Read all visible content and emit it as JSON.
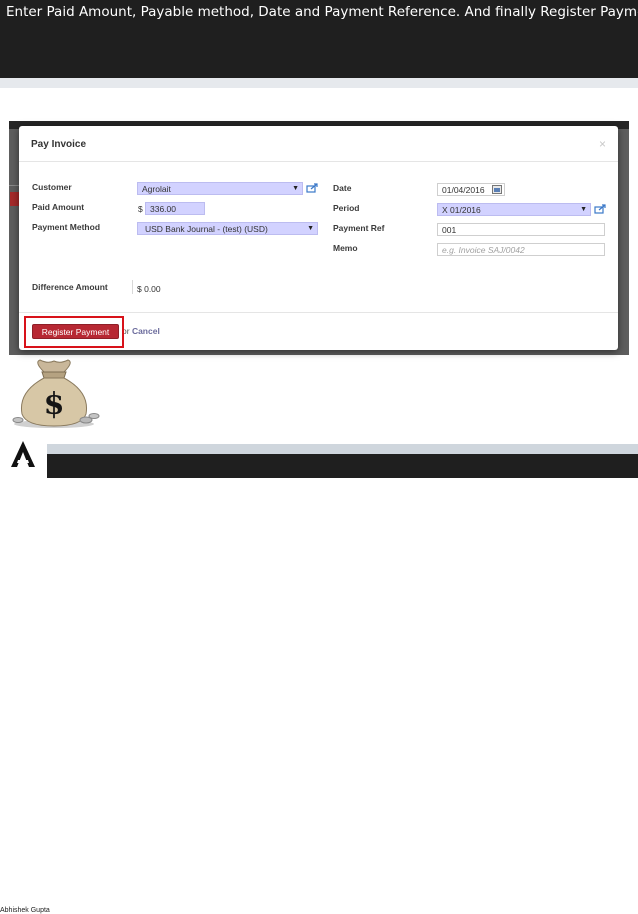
{
  "banner": {
    "caption": "Enter Paid Amount, Payable method, Date and Payment Reference. And finally Register Payment."
  },
  "modal": {
    "title": "Pay Invoice",
    "close_label": "×",
    "left": {
      "customer_label": "Customer",
      "customer_value": "Agrolait",
      "paid_amount_label": "Paid Amount",
      "currency_symbol": "$",
      "paid_amount_value": "336.00",
      "payment_method_label": "Payment Method",
      "payment_method_value": "USD Bank Journal - (test) (USD)",
      "difference_label": "Difference Amount",
      "difference_value": "$ 0.00"
    },
    "right": {
      "date_label": "Date",
      "date_value": "01/04/2016",
      "period_label": "Period",
      "period_value": "X 01/2016",
      "payment_ref_label": "Payment Ref",
      "payment_ref_value": "001",
      "memo_label": "Memo",
      "memo_placeholder": "e.g. Invoice SAJ/0042"
    },
    "footer": {
      "register_label": "Register Payment",
      "or_label": "or",
      "cancel_label": "Cancel"
    }
  },
  "logo": {
    "caption": "Abhishek Gupta"
  },
  "colors": {
    "primary_button": "#b72833",
    "required_field": "#d2d2ff",
    "highlight_outline": "#d8121a"
  }
}
